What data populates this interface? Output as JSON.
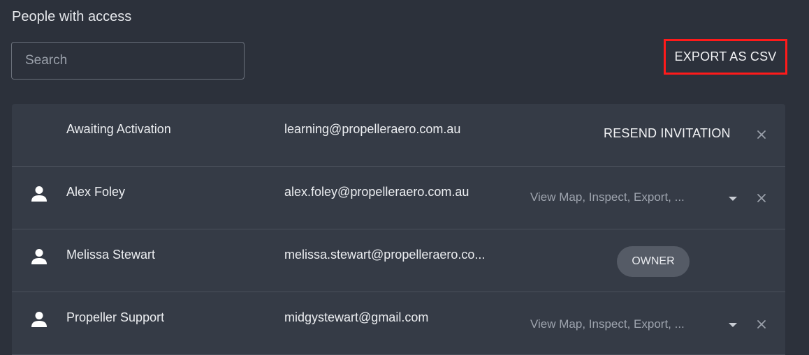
{
  "header": {
    "title": "People with access",
    "export_label": "EXPORT AS CSV"
  },
  "search": {
    "placeholder": "Search",
    "value": ""
  },
  "rows": [
    {
      "name": "Awaiting Activation",
      "email": "learning@propelleraero.com.au",
      "action_label": "RESEND INVITATION",
      "icon": "none"
    },
    {
      "name": "Alex Foley",
      "email": "alex.foley@propelleraero.com.au",
      "permissions": "View Map, Inspect, Export, ...",
      "icon": "person-icon"
    },
    {
      "name": "Melissa Stewart",
      "email": "melissa.stewart@propelleraero.co...",
      "role_badge": "OWNER",
      "icon": "person-icon"
    },
    {
      "name": "Propeller Support",
      "email": "midgystewart@gmail.com",
      "permissions": "View Map, Inspect, Export, ...",
      "icon": "person-icon"
    }
  ],
  "colors": {
    "background": "#2c313b",
    "table": "#353b46",
    "highlight": "#ff1a1a"
  }
}
